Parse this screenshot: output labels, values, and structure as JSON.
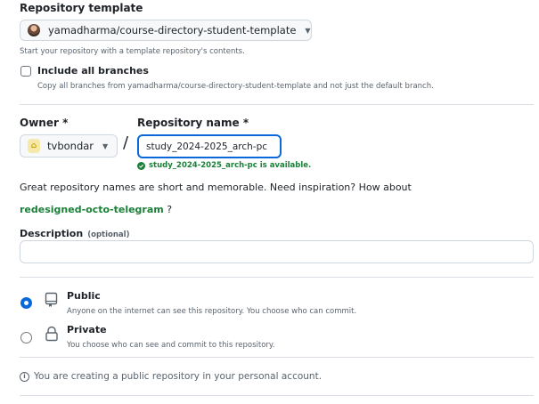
{
  "template": {
    "heading": "Repository template",
    "selected": "yamadharma/course-directory-student-template",
    "hint": "Start your repository with a template repository's contents."
  },
  "include_branches": {
    "label": "Include all branches",
    "hint": "Copy all branches from yamadharma/course-directory-student-template and not just the default branch.",
    "checked": false
  },
  "owner": {
    "label": "Owner *",
    "value": "tvbondar",
    "separator": "/"
  },
  "repo_name": {
    "label": "Repository name *",
    "value": "study_2024-2025_arch-pc",
    "availability": "study_2024-2025_arch-pc is available."
  },
  "suggestion": {
    "text": "Great repository names are short and memorable. Need inspiration? How about",
    "name": "redesigned-octo-telegram",
    "suffix": " ?"
  },
  "description": {
    "label": "Description",
    "optional": "(optional)",
    "value": ""
  },
  "visibility": {
    "selected": "Public",
    "options": [
      {
        "title": "Public",
        "desc": "Anyone on the internet can see this repository. You choose who can commit."
      },
      {
        "title": "Private",
        "desc": "You choose who can see and commit to this repository."
      }
    ]
  },
  "info": {
    "text": "You are creating a public repository in your personal account."
  },
  "colors": {
    "accent": "#0969da",
    "success": "#1a7f37",
    "border": "#d0d7de"
  }
}
